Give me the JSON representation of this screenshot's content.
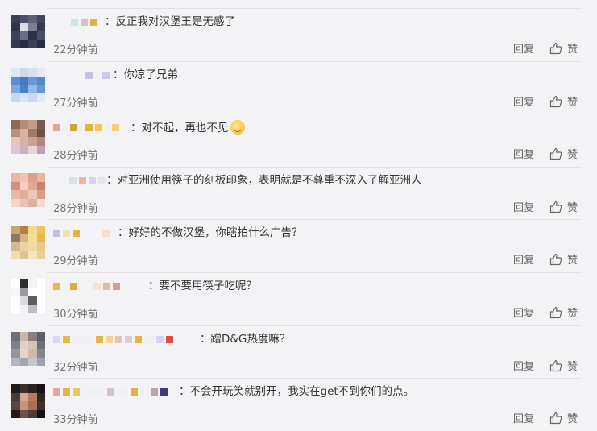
{
  "comments": [
    {
      "text": "：反正我对汉堡王是无感了",
      "time": "22分钟前",
      "reply": "回复",
      "like": "赞"
    },
    {
      "text": "：你凉了兄弟",
      "time": "27分钟前",
      "reply": "回复",
      "like": "赞"
    },
    {
      "text": "：对不起，再也不见",
      "time": "28分钟前",
      "reply": "回复",
      "like": "赞"
    },
    {
      "text": "：对亚洲使用筷子的刻板印象，表明就是不尊重不深入了解亚洲人",
      "time": "28分钟前",
      "reply": "回复",
      "like": "赞"
    },
    {
      "text": "：好好的不做汉堡，你瞎拍什么广告？",
      "time": "29分钟前",
      "reply": "回复",
      "like": "赞"
    },
    {
      "text": "：要不要用筷子吃呢？",
      "time": "30分钟前",
      "reply": "回复",
      "like": "赞"
    },
    {
      "text": "：蹭D&G热度嘛？",
      "time": "32分钟前",
      "reply": "回复",
      "like": "赞"
    },
    {
      "text": "：不会开玩笑就别开，我实在get不到你们的点。",
      "time": "33分钟前",
      "reply": "回复",
      "like": "赞"
    }
  ],
  "icons": {
    "like": "thumbs-up-icon",
    "emoji": "smiley-emoji-icon"
  }
}
